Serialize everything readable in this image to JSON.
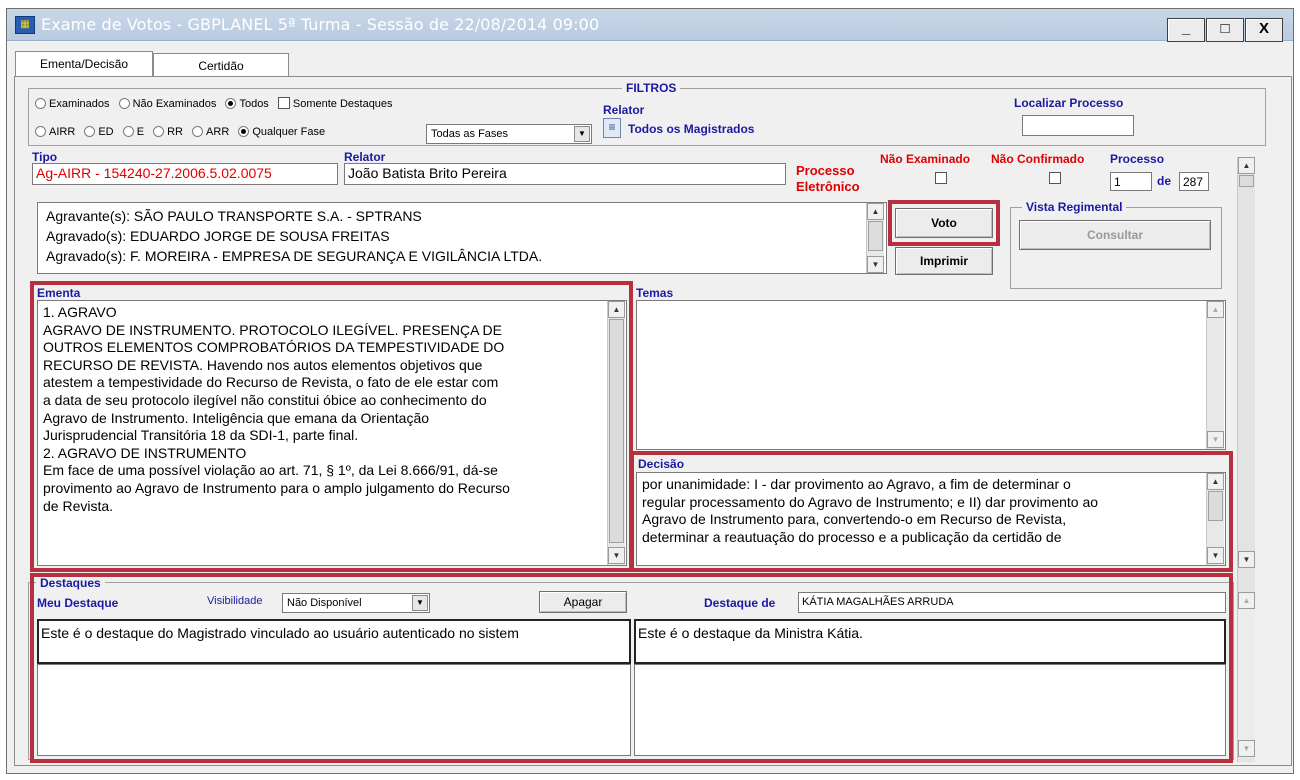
{
  "window": {
    "title": "Exame de Votos - GBPLANEL 5ª Turma - Sessão de 22/08/2014 09:00",
    "controls": {
      "minimize": "_",
      "maximize": "□",
      "close": "X"
    }
  },
  "tabs": [
    {
      "label": "Ementa/Decisão",
      "active": true
    },
    {
      "label": "Certidão",
      "active": false
    }
  ],
  "filters": {
    "legend": "FILTROS",
    "status_options": [
      {
        "label": "Examinados",
        "selected": false
      },
      {
        "label": "Não Examinados",
        "selected": false
      },
      {
        "label": "Todos",
        "selected": true
      }
    ],
    "somente_destaques": {
      "label": "Somente Destaques",
      "checked": false
    },
    "phase_options": [
      {
        "label": "AIRR",
        "selected": false
      },
      {
        "label": "ED",
        "selected": false
      },
      {
        "label": "E",
        "selected": false
      },
      {
        "label": "RR",
        "selected": false
      },
      {
        "label": "ARR",
        "selected": false
      },
      {
        "label": "Qualquer Fase",
        "selected": true
      }
    ],
    "phase_select": "Todas as Fases",
    "relator_label": "Relator",
    "relator_value": "Todos os Magistrados",
    "localizar_label": "Localizar Processo",
    "localizar_value": ""
  },
  "process": {
    "tipo_label": "Tipo",
    "tipo_value": "Ag-AIRR - 154240-27.2006.5.02.0075",
    "relator_label": "Relator",
    "relator_value": "João Batista Brito Pereira",
    "eletronico_line1": "Processo",
    "eletronico_line2": "Eletrônico",
    "nao_examinado_label": "Não Examinado",
    "nao_confirmado_label": "Não Confirmado",
    "processo_label": "Processo",
    "processo_current": "1",
    "de_label": "de",
    "processo_total": "287"
  },
  "parties": [
    "Agravante(s): SÃO PAULO TRANSPORTE S.A. - SPTRANS",
    "Agravado(s): EDUARDO JORGE DE SOUSA FREITAS",
    "Agravado(s): F. MOREIRA - EMPRESA DE SEGURANÇA E VIGILÂNCIA LTDA."
  ],
  "buttons": {
    "voto": "Voto",
    "imprimir": "Imprimir",
    "vista_legend": "Vista Regimental",
    "consultar": "Consultar",
    "apagar": "Apagar"
  },
  "ementa": {
    "label": "Ementa",
    "lines": [
      "1. AGRAVO",
      "AGRAVO DE INSTRUMENTO. PROTOCOLO ILEGÍVEL. PRESENÇA DE",
      "OUTROS ELEMENTOS COMPROBATÓRIOS DA TEMPESTIVIDADE DO",
      "RECURSO DE REVISTA. Havendo nos autos elementos objetivos que",
      "atestem a tempestividade do Recurso de Revista, o fato de ele estar com",
      "a data de seu protocolo ilegível não constitui óbice ao conhecimento do",
      "Agravo de Instrumento. Inteligência que emana da Orientação",
      "Jurisprudencial Transitória 18 da SDI-1, parte final.",
      "2. AGRAVO DE INSTRUMENTO",
      "Em face de uma possível violação ao art. 71, § 1º, da Lei 8.666/91, dá-se",
      "provimento ao Agravo de Instrumento para o amplo julgamento do Recurso",
      "de Revista."
    ]
  },
  "temas": {
    "label": "Temas",
    "text": ""
  },
  "decisao": {
    "label": "Decisão",
    "lines": [
      "por unanimidade: I - dar provimento ao Agravo, a fim de determinar o",
      "regular processamento do Agravo de Instrumento; e II) dar provimento ao",
      "Agravo de Instrumento para, convertendo-o em Recurso de Revista,",
      "determinar a reautuação do processo e a publicação da certidão de"
    ]
  },
  "destaques": {
    "legend": "Destaques",
    "meu_label": "Meu Destaque",
    "visibilidade_label": "Visibilidade",
    "visibilidade_value": "Não Disponível",
    "destaque_de_label": "Destaque de",
    "destaque_de_value": "KÁTIA MAGALHÃES ARRUDA",
    "meu_text": "Este é o destaque do Magistrado vinculado ao usuário autenticado no sistem",
    "outro_text": "Este é o destaque da Ministra Kátia."
  },
  "colors": {
    "highlight": "#b5313f",
    "label_blue": "#1a1aa0",
    "label_red": "#e00000"
  }
}
